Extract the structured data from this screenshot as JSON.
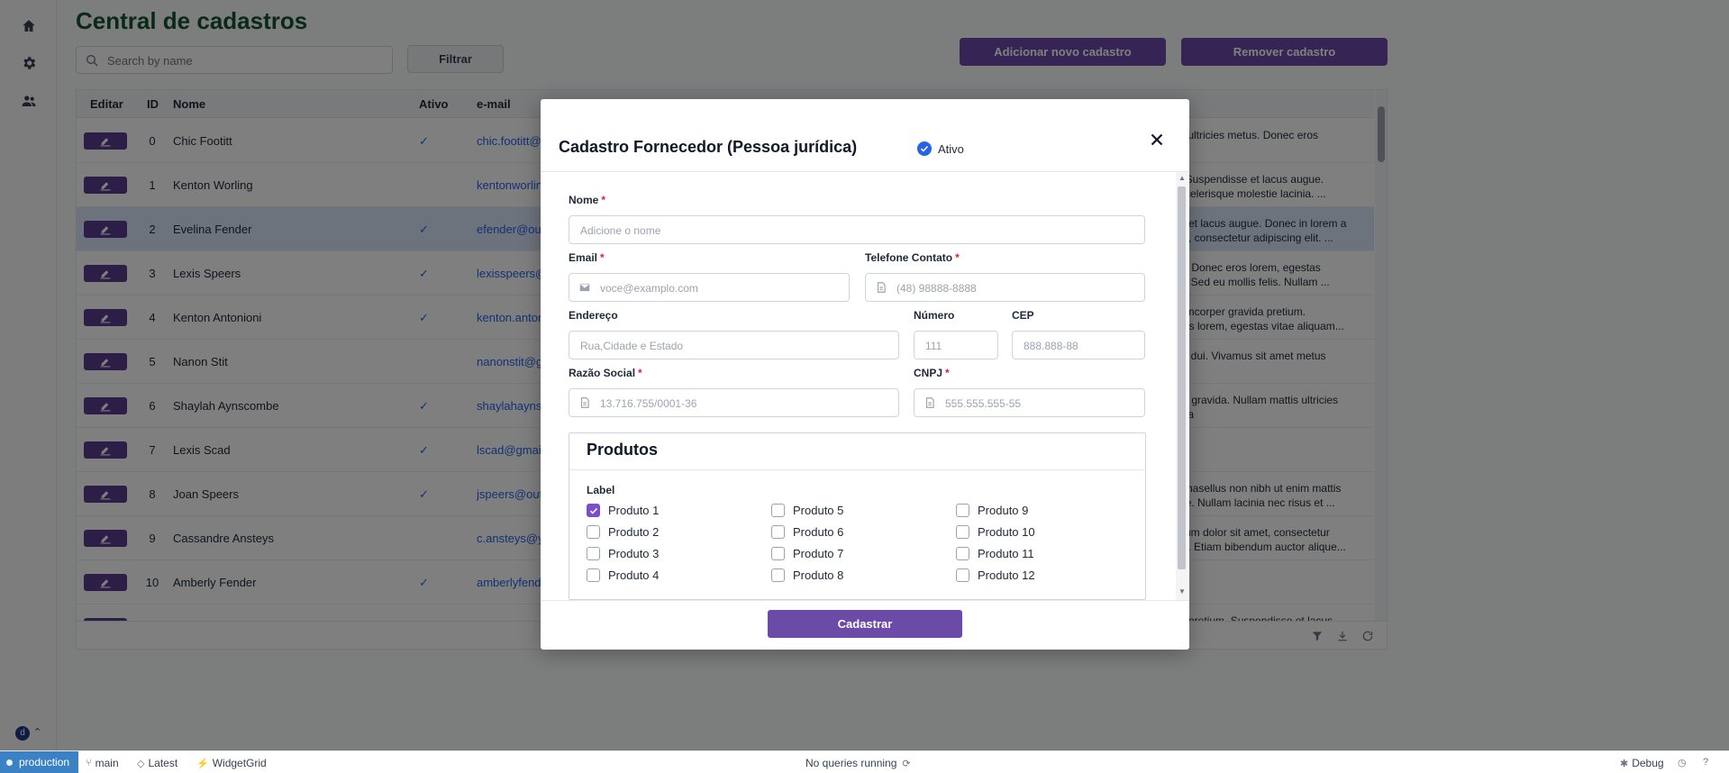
{
  "page": {
    "title": "Central de cadastros",
    "search_placeholder": "Search by name",
    "filter_label": "Filtrar",
    "add_label": "Adicionar novo cadastro",
    "remove_label": "Remover cadastro"
  },
  "table": {
    "headers": {
      "edit": "Editar",
      "id": "ID",
      "name": "Nome",
      "active": "Ativo",
      "email": "e-mail"
    },
    "rows": [
      {
        "id": "0",
        "name": "Chic Footitt",
        "active": "✓",
        "email": "chic.footitt@",
        "desc1": "s ultricies metus. Donec eros",
        "desc2": ""
      },
      {
        "id": "1",
        "name": "Kenton Worling",
        "active": "",
        "email": "kentonworlin",
        "desc1": ". Suspendisse et lacus augue.",
        "desc2": "scelerisque molestie lacinia. ..."
      },
      {
        "id": "2",
        "name": "Evelina Fender",
        "active": "✓",
        "email": "efender@out",
        "desc1": "e et lacus augue. Donec in lorem a",
        "desc2": "et, consectetur adipiscing elit. ..."
      },
      {
        "id": "3",
        "name": "Lexis Speers",
        "active": "✓",
        "email": "lexisspeers@",
        "desc1": "e. Donec eros lorem, egestas",
        "desc2": "s. Sed eu mollis felis. Nullam ..."
      },
      {
        "id": "4",
        "name": "Kenton Antonioni",
        "active": "✓",
        "email": "kenton.anton",
        "desc1": "amcorper gravida pretium.",
        "desc2": "ros lorem, egestas vitae aliquam..."
      },
      {
        "id": "5",
        "name": "Nanon Stit",
        "active": "",
        "email": "nanonstit@g",
        "desc1": "id dui. Vivamus sit amet metus",
        "desc2": ""
      },
      {
        "id": "6",
        "name": "Shaylah Aynscombe",
        "active": "✓",
        "email": "shaylahayns",
        "desc1": "at gravida. Nullam mattis ultricies",
        "desc2": "nia"
      },
      {
        "id": "7",
        "name": "Lexis Scad",
        "active": "✓",
        "email": "lscad@gmail",
        "desc1": "",
        "desc2": ""
      },
      {
        "id": "8",
        "name": "Joan Speers",
        "active": "✓",
        "email": "jspeers@out",
        "desc1": "Phasellus non nibh ut enim mattis",
        "desc2": "ue. Nullam lacinia nec risus et ..."
      },
      {
        "id": "9",
        "name": "Cassandre Ansteys",
        "active": "",
        "email": "c.ansteys@y",
        "desc1": "sum dolor sit amet, consectetur",
        "desc2": "ui. Etiam bibendum auctor alique..."
      },
      {
        "id": "10",
        "name": "Amberly Fender",
        "active": "✓",
        "email": "amberlyfend",
        "desc1": "",
        "desc2": ""
      },
      {
        "id": "",
        "name": "",
        "active": "",
        "email": "",
        "desc1": "a pretium. Suspendisse et lacus",
        "desc2": ""
      }
    ]
  },
  "modal": {
    "title": "Cadastro Fornecedor (Pessoa jurídica)",
    "ativo_label": "Ativo",
    "fields": {
      "nome": {
        "label": "Nome",
        "placeholder": "Adicione o nome"
      },
      "email": {
        "label": "Email",
        "placeholder": "voce@examplo.com"
      },
      "telefone": {
        "label": "Telefone Contato",
        "placeholder": "(48) 98888-8888"
      },
      "endereco": {
        "label": "Endereço",
        "placeholder": "Rua,Cidade e Estado"
      },
      "numero": {
        "label": "Número",
        "placeholder": "111"
      },
      "cep": {
        "label": "CEP",
        "placeholder": "888.888-88"
      },
      "razao": {
        "label": "Razão Social",
        "placeholder": "13.716.755/0001-36"
      },
      "cnpj": {
        "label": "CNPJ",
        "placeholder": "555.555.555-55"
      },
      "required_mark": "*"
    },
    "produtos": {
      "title": "Produtos",
      "label": "Label",
      "items": [
        {
          "label": "Produto 1",
          "checked": true
        },
        {
          "label": "Produto 2",
          "checked": false
        },
        {
          "label": "Produto 3",
          "checked": false
        },
        {
          "label": "Produto 4",
          "checked": false
        },
        {
          "label": "Produto 5",
          "checked": false
        },
        {
          "label": "Produto 6",
          "checked": false
        },
        {
          "label": "Produto 7",
          "checked": false
        },
        {
          "label": "Produto 8",
          "checked": false
        },
        {
          "label": "Produto 9",
          "checked": false
        },
        {
          "label": "Produto 10",
          "checked": false
        },
        {
          "label": "Produto 11",
          "checked": false
        },
        {
          "label": "Produto 12",
          "checked": false
        }
      ]
    },
    "submit_label": "Cadastrar"
  },
  "rail": {
    "avatar_letter": "d"
  },
  "statusbar": {
    "env": "production",
    "branch": "main",
    "tag": "Latest",
    "app": "WidgetGrid",
    "queries": "No queries running",
    "debug": "Debug"
  },
  "colors": {
    "accent": "#6c4aa8",
    "title_green": "#14532d",
    "link": "#2563eb",
    "env": "#3b82c4"
  },
  "icons": [
    "home-icon",
    "gear-icon",
    "users-icon",
    "search-icon",
    "edit-icon",
    "check-icon",
    "close-icon",
    "mail-icon",
    "phone-icon",
    "document-icon",
    "filter-icon",
    "download-icon",
    "refresh-icon",
    "branch-icon",
    "tag-icon",
    "bolt-icon",
    "bug-icon",
    "history-icon",
    "help-icon"
  ]
}
